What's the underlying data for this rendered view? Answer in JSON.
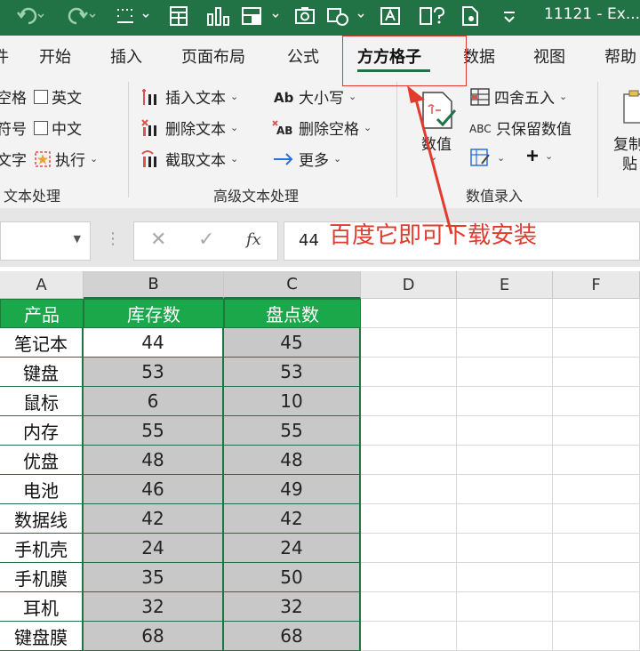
{
  "window": {
    "title": "11121 - Ex..."
  },
  "tabs": [
    "开始",
    "插入",
    "页面布局",
    "公式",
    "方方格子",
    "数据",
    "视图",
    "帮助"
  ],
  "tab_left_partial": "件",
  "ribbon": {
    "group1": {
      "rows": [
        {
          "left_partial": "空格",
          "checkbox": "英文"
        },
        {
          "left_partial": "符号",
          "checkbox": "中文"
        },
        {
          "left_partial": "文字",
          "action": "执行"
        }
      ],
      "label": "文本处理"
    },
    "group2": {
      "col1": [
        "插入文本",
        "删除文本",
        "截取文本"
      ],
      "col2": [
        "大小写",
        "删除空格",
        "更多"
      ],
      "label": "高级文本处理"
    },
    "group3": {
      "big_button": "数值",
      "items": [
        "四舍五入",
        "只保留数值"
      ],
      "label": "数值录入"
    },
    "group4": {
      "big_button_line1": "复制",
      "big_button_line2": "贴"
    }
  },
  "formula_bar": {
    "value": "44"
  },
  "annotation": "百度它即可下载安装",
  "columns": [
    "A",
    "B",
    "C",
    "D",
    "E",
    "F"
  ],
  "table": {
    "headers": [
      "产品",
      "库存数",
      "盘点数"
    ],
    "rows": [
      [
        "笔记本",
        "44",
        "45"
      ],
      [
        "键盘",
        "53",
        "53"
      ],
      [
        "鼠标",
        "6",
        "10"
      ],
      [
        "内存",
        "55",
        "55"
      ],
      [
        "优盘",
        "48",
        "48"
      ],
      [
        "电池",
        "46",
        "49"
      ],
      [
        "数据线",
        "42",
        "42"
      ],
      [
        "手机壳",
        "24",
        "24"
      ],
      [
        "手机膜",
        "35",
        "50"
      ],
      [
        "耳机",
        "32",
        "32"
      ],
      [
        "键盘膜",
        "68",
        "68"
      ]
    ]
  },
  "colors": {
    "accent": "#217346",
    "header_fill": "#1aa84a",
    "annotation": "#e23b2e"
  }
}
